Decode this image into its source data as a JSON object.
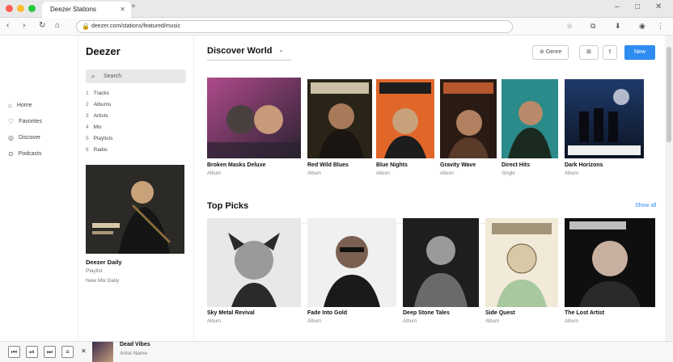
{
  "browser": {
    "tab_title": "Deezer Stations",
    "new_tab": "+",
    "url": "deezer.com/stations/featured/music",
    "controls": [
      "–",
      "□",
      "✕"
    ]
  },
  "nav": {
    "back": "‹",
    "forward": "›",
    "reload": "↻"
  },
  "leftnav": {
    "items": [
      {
        "label": "Home",
        "icon": "home-icon"
      },
      {
        "label": "Favorites",
        "icon": "heart-icon"
      },
      {
        "label": "Discover",
        "icon": "compass-icon"
      },
      {
        "label": "Podcasts",
        "icon": "mic-icon"
      }
    ]
  },
  "sidebar": {
    "logo": "Deezer",
    "search_placeholder": "Search",
    "items": [
      {
        "num": "1",
        "label": "Tracks"
      },
      {
        "num": "2",
        "label": "Albums"
      },
      {
        "num": "3",
        "label": "Artists"
      },
      {
        "num": "4",
        "label": "Mix"
      },
      {
        "num": "5",
        "label": "Playlists"
      },
      {
        "num": "6",
        "label": "Radio"
      }
    ],
    "featured": {
      "title": "Deezer Daily",
      "sub1": "Playlist",
      "sub2": "New Mix Daily"
    }
  },
  "main": {
    "section1_title": "Discover World",
    "toolbar": {
      "filter_label": "Genre",
      "view_label": "⊞",
      "share_label": "⇪",
      "primary_label": "New"
    },
    "row1": [
      {
        "title": "Broken Masks Deluxe",
        "sub": "Album",
        "colors": [
          "#b04a8b",
          "#2a2230"
        ]
      },
      {
        "title": "Red Wild Blues",
        "sub": "Album",
        "colors": [
          "#7a6a45",
          "#2a2418"
        ]
      },
      {
        "title": "Blue Nights",
        "sub": "Album",
        "colors": [
          "#e0662a",
          "#1d1d1d"
        ]
      },
      {
        "title": "Gravity Wave",
        "sub": "Album",
        "colors": [
          "#b5562c",
          "#2a1a14"
        ]
      },
      {
        "title": "Direct Hits",
        "sub": "Single",
        "colors": [
          "#2b8a8a",
          "#1a2a20"
        ]
      },
      {
        "title": "Dark Horizons",
        "sub": "Album",
        "colors": [
          "#1f3a6a",
          "#0c1424"
        ]
      }
    ],
    "section2_title": "Top Picks",
    "see_all": "Show all",
    "row2": [
      {
        "title": "Sky Metal Revival",
        "sub": "Album",
        "colors": [
          "#9a9a9a",
          "#2a2a2a"
        ]
      },
      {
        "title": "Fade Into Gold",
        "sub": "Album",
        "colors": [
          "#c8c8c8",
          "#1a1a1a"
        ]
      },
      {
        "title": "Deep Stone Tales",
        "sub": "Album",
        "colors": [
          "#7a7a7a",
          "#1e1e1e"
        ]
      },
      {
        "title": "Side Quest",
        "sub": "Album",
        "colors": [
          "#d9c8a8",
          "#6a5a3a"
        ]
      },
      {
        "title": "The Lost Artist",
        "sub": "Album",
        "colors": [
          "#555555",
          "#0f0f0f"
        ]
      }
    ],
    "row3": [
      {
        "colors": [
          "#6a3a1a",
          "#2a1a0c"
        ]
      },
      {
        "colors": [
          "#3a8a7a",
          "#c8a070"
        ]
      },
      {
        "colors": [
          "#8a2a2a",
          "#1a1010"
        ]
      },
      {
        "colors": [
          "#e0b040",
          "#1a8a9a"
        ]
      },
      {
        "colors": [
          "#3a2a4a",
          "#e0a0a0"
        ]
      }
    ]
  },
  "player": {
    "controls": [
      "⏮",
      "⏯",
      "⏭",
      "≡",
      "✕"
    ],
    "track_title": "Dead Vibes",
    "track_artist": "Artist Name"
  }
}
